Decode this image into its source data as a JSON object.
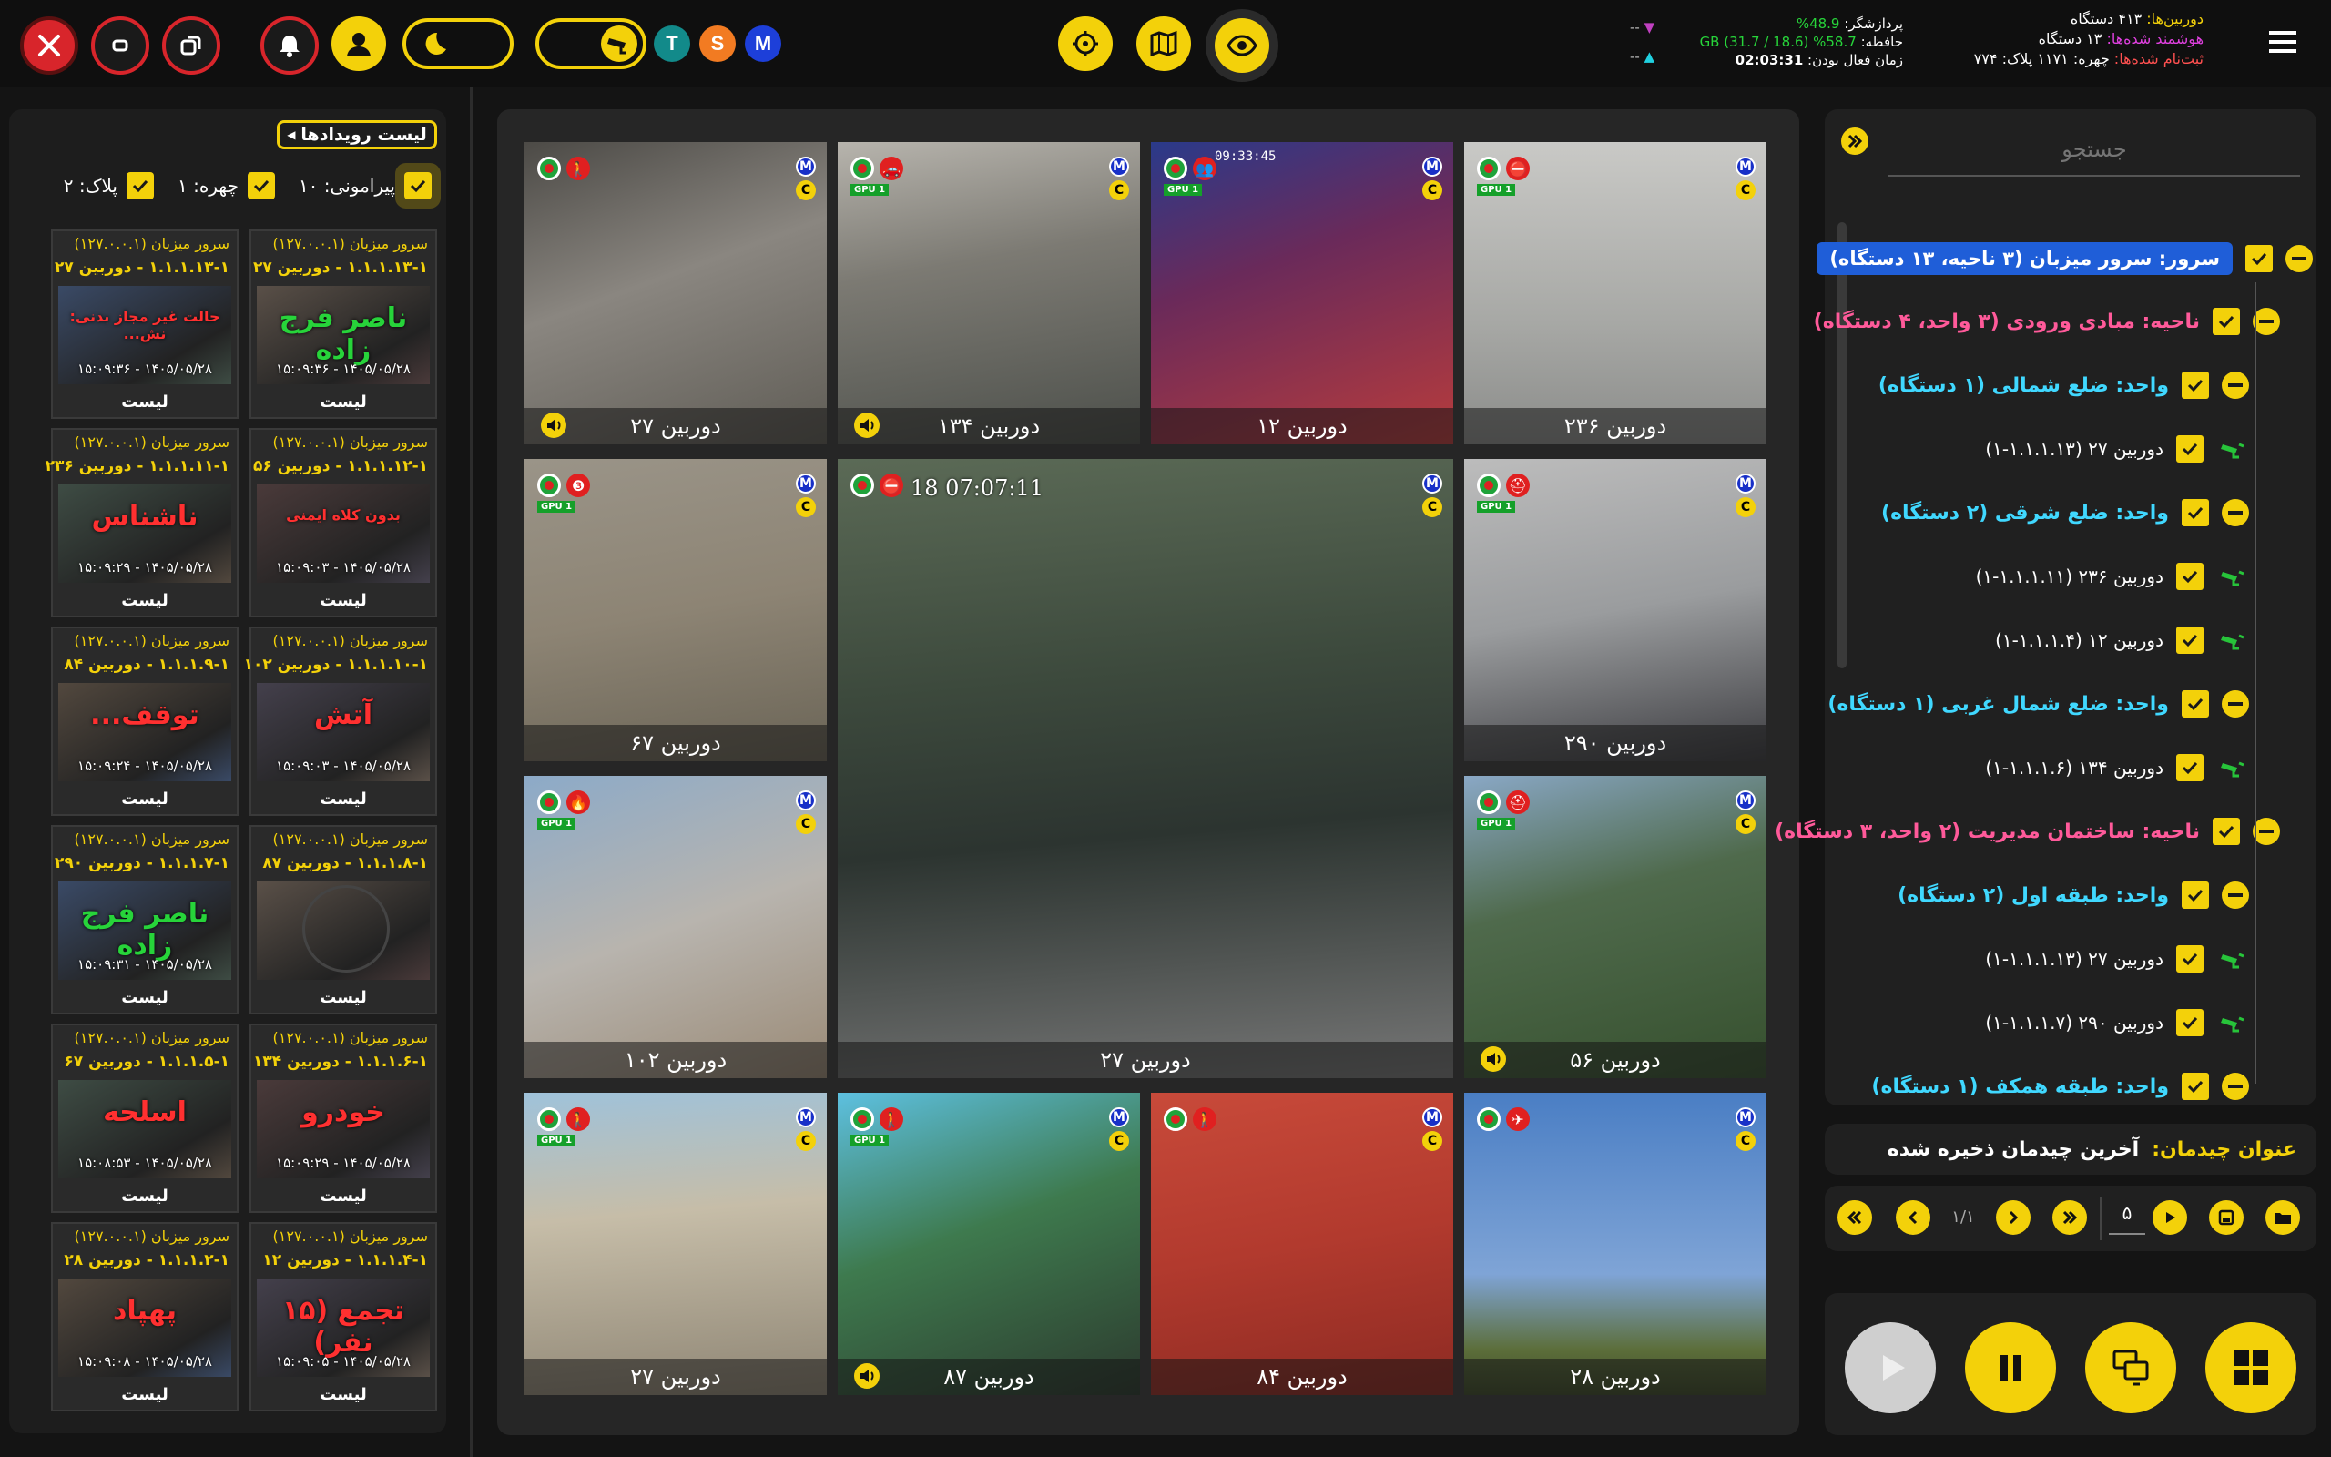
{
  "topbar": {
    "stats_right": {
      "cameras_label": "دوربین‌ها:",
      "cameras_value": "۴۱۳ دستگاه",
      "smart_label": "هوشمند شده‌ها:",
      "smart_value": "۱۳ دستگاه",
      "registered_label": "ثبت‌نام شده‌ها:",
      "face_value": "چهره: ۱۱۷۱",
      "plate_value": "پلاک: ۷۷۴"
    },
    "stats_mid": {
      "cpu_label": "پردازشگر:",
      "cpu_value": "48.9%",
      "mem_label": "حافظه:",
      "mem_value": "58.7% (18.6 / 31.7) GB",
      "uptime_label": "زمان فعال بودن:",
      "uptime_value": "02:03:31"
    },
    "net": {
      "down": "--",
      "up": "--"
    },
    "badges": [
      "T",
      "S",
      "M"
    ],
    "colors": {
      "accent": "#f3d10a",
      "close": "#d8252b",
      "T": "#128a8a",
      "S": "#f27b22",
      "M": "#1d3fd9"
    }
  },
  "events": {
    "title": "لیست رویدادها",
    "filters": [
      {
        "label": "پیرامونی: ۱۰"
      },
      {
        "label": "چهره: ۱"
      },
      {
        "label": "پلاک: ۲"
      }
    ],
    "cards": [
      {
        "server": "سرور میزبان (۱۲۷.۰.۰.۱)",
        "camera": "۱.۱.۱.۱۳-۱ - دوربین ۲۷",
        "label": "ناصر فرج زاده",
        "color": "#27d43a",
        "time": "۱۴۰۵/۰۵/۲۸ - ۱۵:۰۹:۳۶",
        "list": "لیست"
      },
      {
        "server": "سرور میزبان (۱۲۷.۰.۰.۱)",
        "camera": "۱.۱.۱.۱۳-۱ - دوربین ۲۷",
        "label": "حالت غیر مجاز بدنی: نش...",
        "color": "#ff3030",
        "time": "۱۴۰۵/۰۵/۲۸ - ۱۵:۰۹:۳۶",
        "list": "لیست"
      },
      {
        "server": "سرور میزبان (۱۲۷.۰.۰.۱)",
        "camera": "۱.۱.۱.۱۲-۱ - دوربین ۵۶",
        "label": "بدون کلاه ایمنی",
        "color": "#ff3030",
        "time": "۱۴۰۵/۰۵/۲۸ - ۱۵:۰۹:۰۳",
        "list": "لیست"
      },
      {
        "server": "سرور میزبان (۱۲۷.۰.۰.۱)",
        "camera": "۱.۱.۱.۱۱-۱ - دوربین ۲۳۶",
        "label": "ناشناس",
        "color": "#ff3030",
        "time": "۱۴۰۵/۰۵/۲۸ - ۱۵:۰۹:۲۹",
        "list": "لیست"
      },
      {
        "server": "سرور میزبان (۱۲۷.۰.۰.۱)",
        "camera": "۱.۱.۱.۱۰-۱ - دوربین ۱۰۲",
        "label": "آتش",
        "color": "#ff3030",
        "time": "۱۴۰۵/۰۵/۲۸ - ۱۵:۰۹:۰۳",
        "list": "لیست"
      },
      {
        "server": "سرور میزبان (۱۲۷.۰.۰.۱)",
        "camera": "۱.۱.۱.۹-۱ - دوربین ۸۴",
        "label": "توقف...",
        "color": "#ff3030",
        "time": "۱۴۰۵/۰۵/۲۸ - ۱۵:۰۹:۲۴",
        "list": "لیست"
      },
      {
        "server": "سرور میزبان (۱۲۷.۰.۰.۱)",
        "camera": "۱.۱.۱.۸-۱ - دوربین ۸۷",
        "label": "",
        "color": "#ff3030",
        "time": "",
        "list": "لیست"
      },
      {
        "server": "سرور میزبان (۱۲۷.۰.۰.۱)",
        "camera": "۱.۱.۱.۷-۱ - دوربین ۲۹۰",
        "label": "ناصر فرج زاده",
        "color": "#27d43a",
        "time": "۱۴۰۵/۰۵/۲۸ - ۱۵:۰۹:۳۱",
        "list": "لیست"
      },
      {
        "server": "سرور میزبان (۱۲۷.۰.۰.۱)",
        "camera": "۱.۱.۱.۶-۱ - دوربین ۱۳۴",
        "label": "خودرو",
        "color": "#ff3030",
        "time": "۱۴۰۵/۰۵/۲۸ - ۱۵:۰۹:۲۹",
        "list": "لیست"
      },
      {
        "server": "سرور میزبان (۱۲۷.۰.۰.۱)",
        "camera": "۱.۱.۱.۵-۱ - دوربین ۶۷",
        "label": "اسلحه",
        "color": "#ff3030",
        "time": "۱۴۰۵/۰۵/۲۸ - ۱۵:۰۸:۵۳",
        "list": "لیست"
      },
      {
        "server": "سرور میزبان (۱۲۷.۰.۰.۱)",
        "camera": "۱.۱.۱.۴-۱ - دوربین ۱۲",
        "label": "تجمع (۱۵ نفر)",
        "color": "#ff3030",
        "time": "۱۴۰۵/۰۵/۲۸ - ۱۵:۰۹:۰۵",
        "list": "لیست"
      },
      {
        "server": "سرور میزبان (۱۲۷.۰.۰.۱)",
        "camera": "۱.۱.۱.۲-۱ - دوربین ۲۸",
        "label": "پهپاد",
        "color": "#ff3030",
        "time": "۱۴۰۵/۰۵/۲۸ - ۱۵:۰۹:۰۸",
        "list": "لیست"
      }
    ]
  },
  "grid": {
    "timestamps": [
      "09:33:45",
      "18 07:07:11"
    ],
    "tiles": [
      {
        "caption": "دوربین ۲۷",
        "bg": "linear-gradient(160deg,#4c4a46 0%,#8a8680 45%,#5f5c55 100%)",
        "audio": true,
        "gpu": false,
        "icon": "person-icon"
      },
      {
        "caption": "دوربین ۱۳۴",
        "bg": "linear-gradient(170deg,#b7b4ad 0%,#7c7a73 40%,#4c4f4a 100%)",
        "audio": true,
        "gpu": true,
        "icon": "car-icon"
      },
      {
        "caption": "دوربین ۱۲",
        "bg": "linear-gradient(160deg,#2a3a8a 0%,#6a2a5a 40%,#b83c3c 100%)",
        "audio": false,
        "gpu": true,
        "icon": "crowd-icon"
      },
      {
        "caption": "دوربین ۲۳۶",
        "bg": "linear-gradient(180deg,#c9c9c6 0%,#a7a8a5 60%,#8b8c8a 100%)",
        "audio": false,
        "gpu": true,
        "icon": "no-entry-icon"
      },
      {
        "caption": "دوربین ۶۷",
        "bg": "linear-gradient(170deg,#9a9488 0%,#8d8474 50%,#6a6456 100%)",
        "audio": false,
        "gpu": true,
        "icon": "gun-icon"
      },
      {
        "caption": "دوربین ۲۷",
        "bg": "linear-gradient(175deg,#5b6a56 0%,#3d4a3d 35%,#2c3430 60%,#777 100%)",
        "audio": false,
        "gpu": false,
        "icon": "no-entry-icon"
      },
      {
        "caption": "دوربین ۲۹۰",
        "bg": "linear-gradient(170deg,#bcbcbc 0%,#9a9c9e 50%,#3c3c40 100%)",
        "audio": false,
        "gpu": true,
        "icon": "helmet-icon"
      },
      {
        "caption": "دوربین ۱۰۲",
        "bg": "linear-gradient(160deg,#8caac8 0%,#b8b4ae 50%,#9a8a76 100%)",
        "audio": false,
        "gpu": true,
        "icon": "fire-icon"
      },
      {
        "caption": "دوربین ۵۶",
        "bg": "linear-gradient(165deg,#8aa8c6 0%,#4f6a4c 40%,#36502e 100%)",
        "audio": true,
        "gpu": true,
        "icon": "helmet-icon"
      },
      {
        "caption": "دوربین ۲۷",
        "bg": "linear-gradient(175deg,#9fc2da 0%,#c6bda8 40%,#8e8574 100%)",
        "audio": false,
        "gpu": true,
        "icon": "person-icon"
      },
      {
        "caption": "دوربین ۸۷",
        "bg": "linear-gradient(160deg,#5dc0e0 0%,#3e7a4e 45%,#2c3a2e 100%)",
        "audio": true,
        "gpu": true,
        "icon": "person-icon"
      },
      {
        "caption": "دوربین ۸۴",
        "bg": "linear-gradient(170deg,#c84a3a 0%,#b23a2e 50%,#8c2a22 100%)",
        "audio": false,
        "gpu": false,
        "icon": "person-icon"
      },
      {
        "caption": "دوربین ۲۸",
        "bg": "linear-gradient(180deg,#4a7ec4 0%,#7fa4d6 60%,#5c6e3a 85%,#3d4a2a 100%)",
        "audio": false,
        "gpu": false,
        "icon": "drone-icon"
      }
    ]
  },
  "tree": {
    "search_placeholder": "جستجو",
    "server": "سرور: سرور میزبان (۳ ناحیه، ۱۳ دستگاه)",
    "nodes": [
      {
        "type": "region",
        "label": "ناحیه: مبادی ورودی (۳ واحد، ۴ دستگاه)"
      },
      {
        "type": "unit",
        "label": "واحد: ضلع شمالی (۱ دستگاه)"
      },
      {
        "type": "camera",
        "label": "دوربین ۲۷ (۱.۱.۱.۱۳-۱)"
      },
      {
        "type": "unit",
        "label": "واحد: ضلع شرقی (۲ دستگاه)"
      },
      {
        "type": "camera",
        "label": "دوربین ۲۳۶ (۱.۱.۱.۱۱-۱)"
      },
      {
        "type": "camera",
        "label": "دوربین ۱۲ (۱.۱.۱.۴-۱)"
      },
      {
        "type": "unit",
        "label": "واحد: ضلع شمال غربی (۱ دستگاه)"
      },
      {
        "type": "camera",
        "label": "دوربین ۱۳۴ (۱.۱.۱.۶-۱)"
      },
      {
        "type": "region",
        "label": "ناحیه: ساختمان مدیریت (۲ واحد، ۳ دستگاه)"
      },
      {
        "type": "unit",
        "label": "واحد: طبقه اول (۲ دستگاه)"
      },
      {
        "type": "camera",
        "label": "دوربین ۲۷ (۱.۱.۱.۱۳-۱)"
      },
      {
        "type": "camera",
        "label": "دوربین ۲۹۰ (۱.۱.۱.۷-۱)"
      },
      {
        "type": "unit",
        "label": "واحد: طبقه همکف (۱ دستگاه)"
      }
    ]
  },
  "layout_box": {
    "label": "عنوان چیدمان:",
    "value": "آخرین چیدمان ذخیره شده"
  },
  "pager": {
    "page": "۱/۱",
    "count": "۵"
  }
}
